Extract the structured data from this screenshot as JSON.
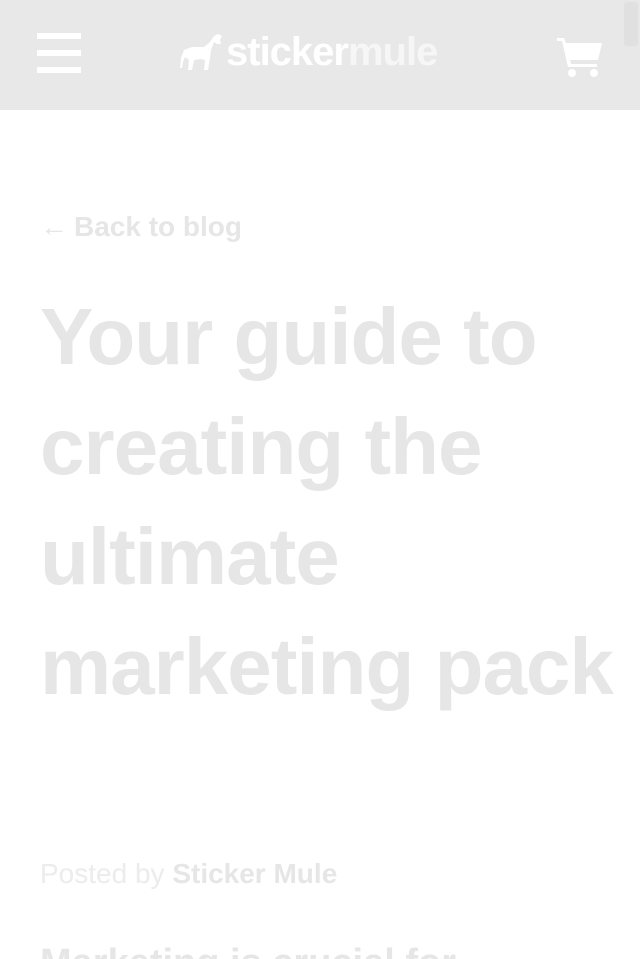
{
  "header": {
    "brand_primary": "sticker",
    "brand_secondary": "mule",
    "background_color": "#e8e8e8"
  },
  "article": {
    "back_label": "Back to blog",
    "back_arrow": "←",
    "title": "Your guide to creating the ultimate marketing pack",
    "byline_prefix": "Posted by",
    "author": "Sticker Mule",
    "intro_partial": "Marketing is crucial for"
  },
  "icons": {
    "menu": "hamburger-menu-icon",
    "logo": "mule-logo-icon",
    "cart": "shopping-cart-icon"
  },
  "colors": {
    "text_faded": "#e6e6e6",
    "header_bg": "#e8e8e8",
    "icon": "#ffffff"
  }
}
